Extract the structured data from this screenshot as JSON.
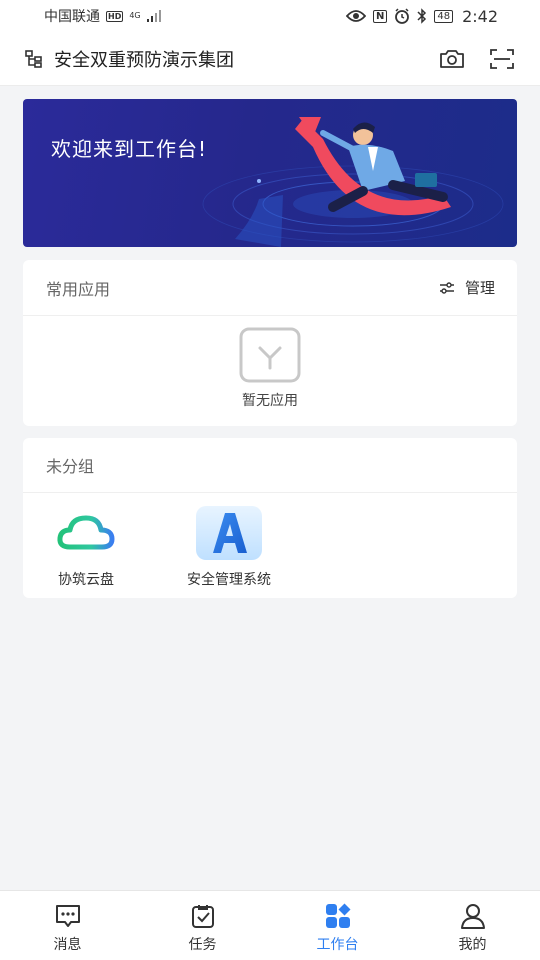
{
  "status_bar": {
    "carrier": "中国联通",
    "hd_badge": "HD",
    "network": "4G",
    "nfc": "N",
    "battery": "48",
    "time": "2:42"
  },
  "header": {
    "title": "安全双重预防演示集团",
    "icons": [
      "org-chart-icon",
      "camera-icon",
      "scan-icon"
    ]
  },
  "banner": {
    "text": "欢迎来到工作台!"
  },
  "common_apps": {
    "title": "常用应用",
    "manage_label": "管理",
    "empty_label": "暂无应用"
  },
  "ungrouped": {
    "title": "未分组",
    "apps": [
      {
        "label": "协筑云盘",
        "icon": "cloud-icon"
      },
      {
        "label": "安全管理系统",
        "icon": "letter-a-icon"
      }
    ]
  },
  "bottom_nav": {
    "items": [
      {
        "label": "消息",
        "icon": "message-icon"
      },
      {
        "label": "任务",
        "icon": "task-icon"
      },
      {
        "label": "工作台",
        "icon": "workbench-icon",
        "active": true
      },
      {
        "label": "我的",
        "icon": "profile-icon"
      }
    ],
    "active_color": "#2f7ff0"
  }
}
